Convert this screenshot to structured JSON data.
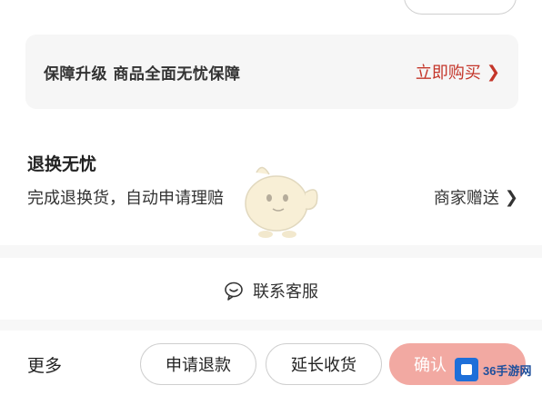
{
  "upgrade_card": {
    "text": "保障升级  商品全面无忧保障",
    "buy_label": "立即购买"
  },
  "worry_free": {
    "title": "退换无忧",
    "description": "完成退换货，自动申请理赔",
    "merchant_gift": "商家赠送"
  },
  "contact": {
    "label": "联系客服"
  },
  "actions": {
    "more_label": "更多",
    "refund_label": "申请退款",
    "extend_label": "延长收货",
    "confirm_label": "确认"
  },
  "watermark": {
    "text": "36手游网"
  },
  "colors": {
    "accent_red": "#c4362a",
    "confirm_bg": "#f2a9a2",
    "card_bg": "#f6f6f6"
  }
}
